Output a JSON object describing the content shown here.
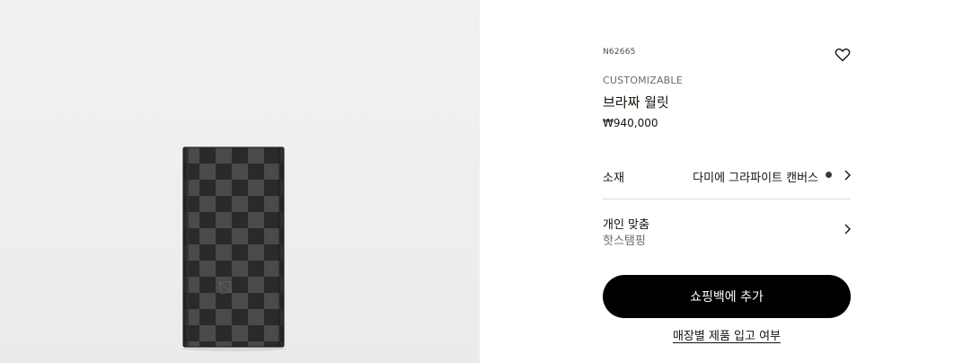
{
  "product": {
    "sku": "N62665",
    "tag": "CUSTOMIZABLE",
    "name": "브라짜 월릿",
    "price": "₩940,000"
  },
  "material": {
    "label": "소재",
    "value": "다미에 그라파이트 캔버스",
    "swatch_color": "#3a3a3a"
  },
  "personalization": {
    "label": "개인 맞춤",
    "sub": "핫스탬핑"
  },
  "actions": {
    "add_to_bag": "쇼핑백에 추가",
    "store_availability": "매장별 제품 입고 여부"
  },
  "icons": {
    "wishlist": "heart-icon",
    "chevron": "chevron-right-icon"
  },
  "colors": {
    "primary_button": "#000000",
    "text": "#19110b",
    "image_background": "#efefee"
  }
}
